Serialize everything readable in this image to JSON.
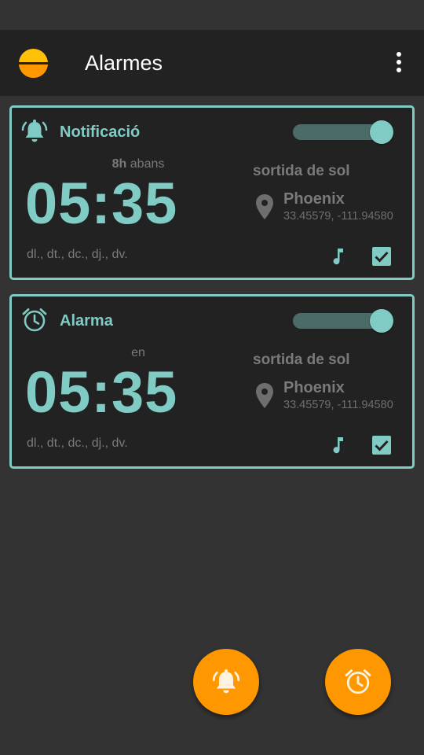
{
  "app": {
    "title": "Alarmes"
  },
  "colors": {
    "accent": "#80cbc4",
    "fab": "#ff9800",
    "background": "#333333",
    "card": "#222222"
  },
  "alarms": [
    {
      "type_label": "Notificació",
      "icon": "bell-ring-icon",
      "enabled": true,
      "offset_value": "8h",
      "offset_word": "abans",
      "time": "05:35",
      "event": "sortida de sol",
      "location": "Phoenix",
      "coords": "33.45579, -111.94580",
      "days": "dl., dt., dc., dj., dv."
    },
    {
      "type_label": "Alarma",
      "icon": "alarm-clock-icon",
      "enabled": true,
      "offset_value": "",
      "offset_word": "en",
      "time": "05:35",
      "event": "sortida de sol",
      "location": "Phoenix",
      "coords": "33.45579, -111.94580",
      "days": "dl., dt., dc., dj., dv."
    }
  ],
  "fabs": [
    {
      "icon": "add-notification-bell-icon"
    },
    {
      "icon": "add-alarm-clock-icon"
    }
  ]
}
